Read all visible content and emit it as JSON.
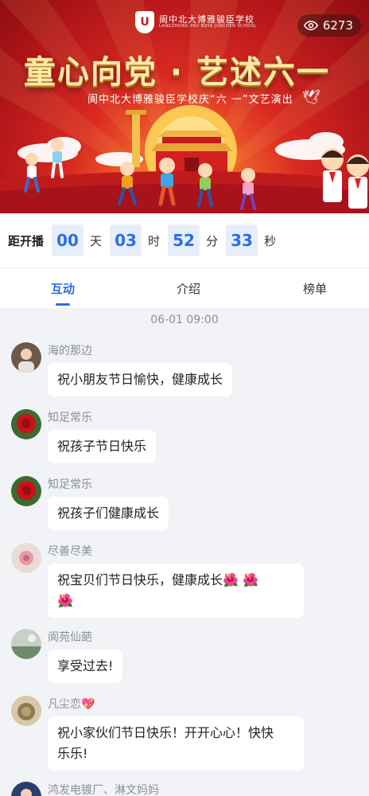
{
  "banner": {
    "logo_text": "阆中北大博雅骏臣学校",
    "logo_subtext": "LANGZHONG PKU BOYA JUNCHEN SCHOOL",
    "views": "6273",
    "title": "童心向党 · 艺述六一",
    "subtitle": "阆中北大博雅骏臣学校庆“六 一”文艺演出"
  },
  "countdown": {
    "label": "距开播",
    "days": "00",
    "days_unit": "天",
    "hours": "03",
    "hours_unit": "时",
    "minutes": "52",
    "minutes_unit": "分",
    "seconds": "33",
    "seconds_unit": "秒"
  },
  "tabs": [
    "互动",
    "介绍",
    "榜单"
  ],
  "chat": {
    "timestamp": "06-01 09:00",
    "messages": [
      {
        "name": "海的那边",
        "text": "祝小朋友节日愉快，健康成长"
      },
      {
        "name": "知足常乐",
        "text": "祝孩子节日快乐"
      },
      {
        "name": "知足常乐",
        "text": "祝孩子们健康成长"
      },
      {
        "name": "尽善尽美",
        "text": "祝宝贝们节日快乐，健康成长🌺 🌺",
        "text2": "🌺"
      },
      {
        "name": "阆苑仙葩",
        "text": "享受过去!"
      },
      {
        "name": "凡尘恋💖",
        "text": "祝小家伙们节日快乐！开开心心！快快",
        "text2": "乐乐!"
      },
      {
        "name": "鸿发电镀厂、淋文妈妈",
        "text": ""
      }
    ]
  },
  "colors": {
    "accent": "#2c6de4",
    "banner_red": "#c51a1e"
  }
}
